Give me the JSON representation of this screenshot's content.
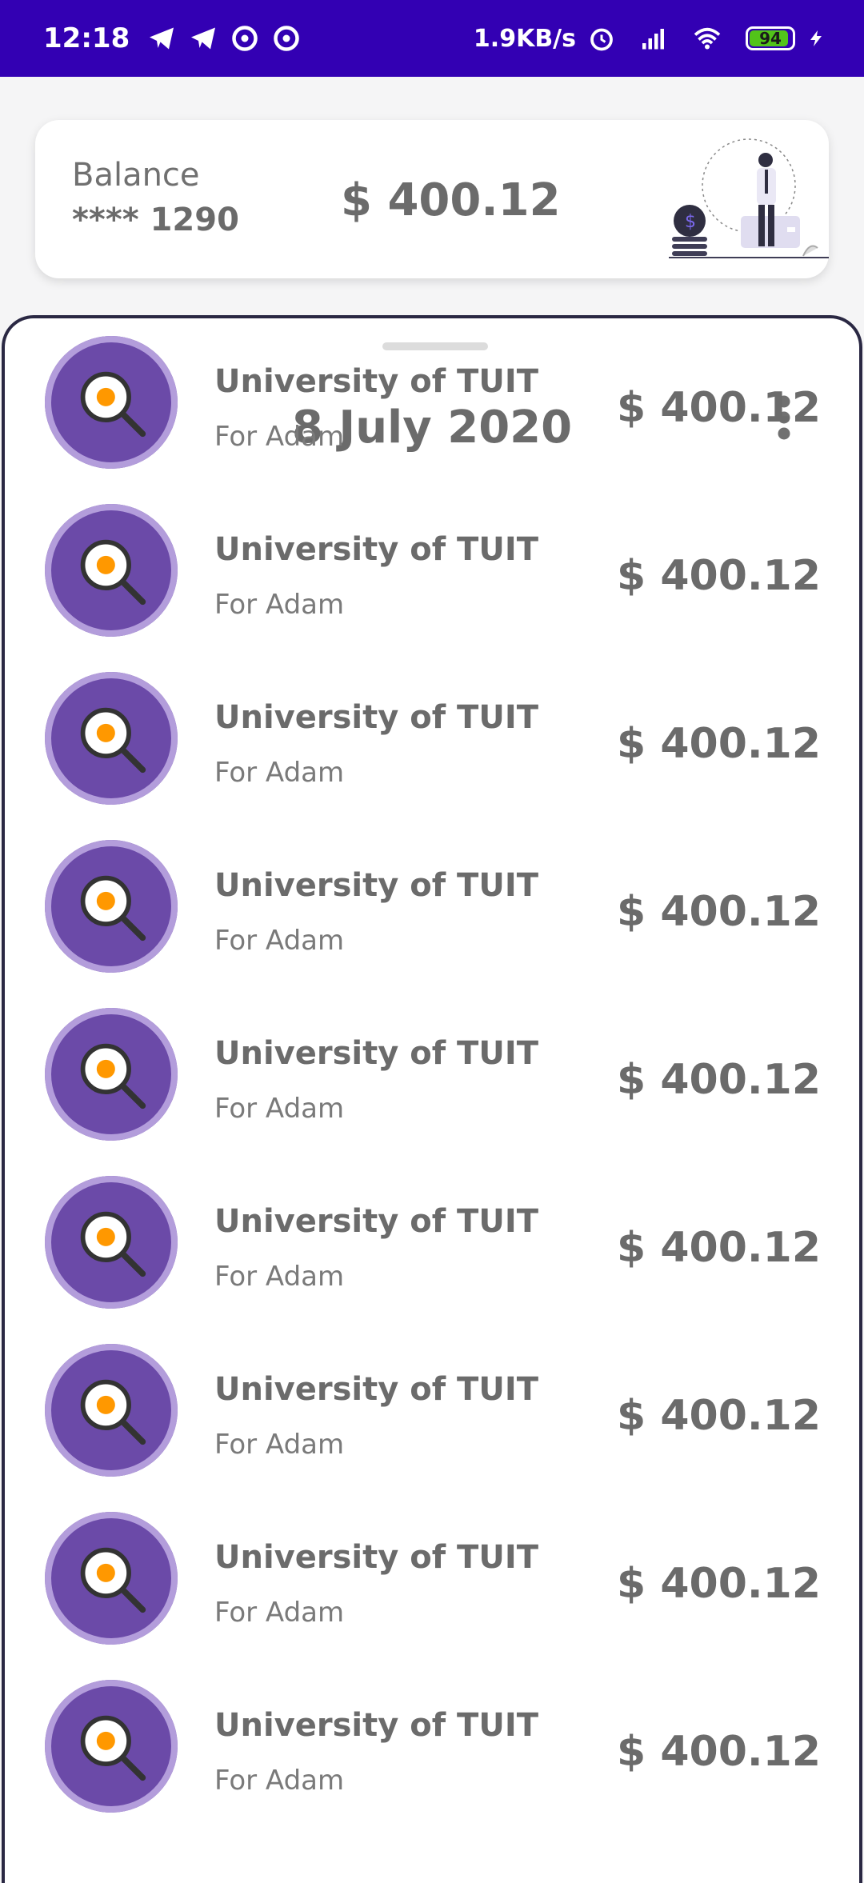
{
  "status_bar": {
    "time": "12:18",
    "net_speed": "1.9KB/s",
    "battery": "94",
    "icons": [
      "telegram-icon",
      "telegram-icon",
      "app-icon",
      "app-icon",
      "alarm-icon",
      "signal-icon",
      "wifi-icon",
      "battery-icon",
      "charging-icon"
    ],
    "bg_color": "#3300b3"
  },
  "balance_card": {
    "label": "Balance",
    "card_number": "**** 1290",
    "amount": "$ 400.12"
  },
  "sheet": {
    "date": "8 July 2020"
  },
  "transactions": [
    {
      "title": "University of TUIT",
      "subtitle": "For Adam",
      "amount": "$ 400.12"
    },
    {
      "title": "University of TUIT",
      "subtitle": "For Adam",
      "amount": "$ 400.12"
    },
    {
      "title": "University of TUIT",
      "subtitle": "For Adam",
      "amount": "$ 400.12"
    },
    {
      "title": "University of TUIT",
      "subtitle": "For Adam",
      "amount": "$ 400.12"
    },
    {
      "title": "University of TUIT",
      "subtitle": "For Adam",
      "amount": "$ 400.12"
    },
    {
      "title": "University of TUIT",
      "subtitle": "For Adam",
      "amount": "$ 400.12"
    },
    {
      "title": "University of TUIT",
      "subtitle": "For Adam",
      "amount": "$ 400.12"
    },
    {
      "title": "University of TUIT",
      "subtitle": "For Adam",
      "amount": "$ 400.12"
    },
    {
      "title": "University of TUIT",
      "subtitle": "For Adam",
      "amount": "$ 400.12"
    }
  ],
  "colors": {
    "avatar": "#6b4aa8",
    "avatar_ring": "#b39ddb",
    "text": "#6b6b6b"
  }
}
